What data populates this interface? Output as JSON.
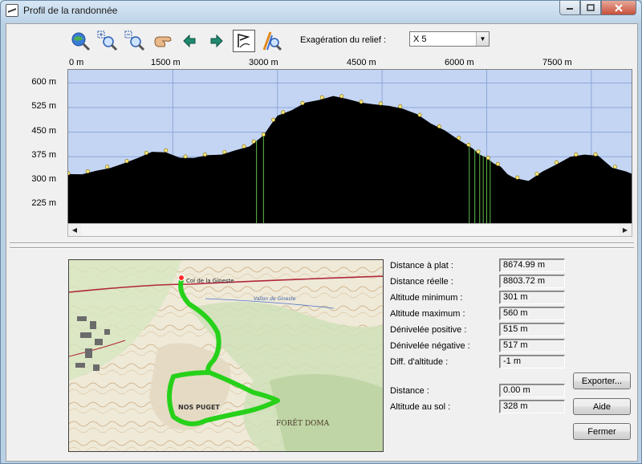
{
  "window": {
    "title": "Profil de la randonnée"
  },
  "toolbar": {
    "icons": [
      "globe-search-icon",
      "zoom-in-icon",
      "zoom-out-icon",
      "pan-hand-icon",
      "arrow-left-icon",
      "arrow-right-icon",
      "flag-route-icon",
      "route-search-icon"
    ],
    "exaggeration_label": "Exagération du relief :",
    "exaggeration_value": "X 5"
  },
  "chart_data": {
    "type": "area",
    "xlabel": "",
    "ylabel": "",
    "x_ticks": [
      "0 m",
      "1500 m",
      "3000 m",
      "4500 m",
      "6000 m",
      "7500 m"
    ],
    "y_ticks": [
      "600 m",
      "525 m",
      "450 m",
      "375 m",
      "300 m",
      "225 m"
    ],
    "xlim": [
      0,
      8100
    ],
    "ylim": [
      165,
      640
    ],
    "grid": true,
    "colors": {
      "sky": "#c4d5f4",
      "terrain": "#000000",
      "grid": "#8ea6d8",
      "waypoint": "#ffe87a"
    },
    "x": [
      0,
      200,
      400,
      600,
      800,
      1000,
      1200,
      1400,
      1600,
      1800,
      2000,
      2200,
      2400,
      2600,
      2800,
      2900,
      3000,
      3200,
      3400,
      3600,
      3800,
      4000,
      4200,
      4400,
      4600,
      4800,
      5000,
      5200,
      5400,
      5600,
      5800,
      5900,
      6000,
      6100,
      6200,
      6300,
      6400,
      6600,
      6800,
      7000,
      7200,
      7400,
      7600,
      7800,
      8000,
      8100
    ],
    "y": [
      322,
      325,
      332,
      344,
      355,
      375,
      390,
      392,
      372,
      375,
      380,
      385,
      395,
      410,
      440,
      475,
      500,
      520,
      540,
      552,
      560,
      555,
      540,
      538,
      530,
      525,
      505,
      480,
      455,
      430,
      400,
      385,
      372,
      358,
      345,
      325,
      310,
      305,
      330,
      355,
      375,
      385,
      378,
      345,
      330,
      325
    ]
  },
  "stats": [
    {
      "label": "Distance à plat :",
      "value": "8674.99 m"
    },
    {
      "label": "Distance réelle :",
      "value": "8803.72 m"
    },
    {
      "label": "Altitude minimum :",
      "value": "301 m"
    },
    {
      "label": "Altitude maximum :",
      "value": "560 m"
    },
    {
      "label": "Dénivelée positive :",
      "value": "515 m"
    },
    {
      "label": "Dénivelée négative :",
      "value": "517 m"
    },
    {
      "label": "Diff. d'altitude :",
      "value": "-1 m"
    }
  ],
  "cursor": {
    "distance_label": "Distance :",
    "distance_value": "0.00 m",
    "ground_label": "Altitude au sol :",
    "ground_value": "328 m"
  },
  "buttons": {
    "export": "Exporter...",
    "help": "Aide",
    "close": "Fermer"
  },
  "map": {
    "labels": [
      "Col de la Gineste",
      "Vallon de Gineste",
      "NOS PUGET",
      "FORÊT DOMA"
    ]
  }
}
